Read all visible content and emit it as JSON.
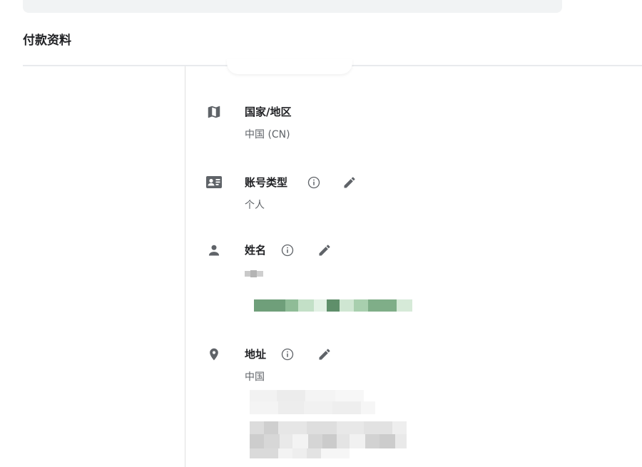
{
  "section": {
    "title": "付款资料"
  },
  "fields": {
    "country": {
      "label": "国家/地区",
      "value": "中国 (CN)",
      "icon": "map-icon"
    },
    "account_type": {
      "label": "账号类型",
      "value": "个人",
      "icon": "id-card-icon",
      "info_icon": "info-icon",
      "edit_icon": "pencil-icon"
    },
    "name": {
      "label": "姓名",
      "icon": "person-icon",
      "info_icon": "info-icon",
      "edit_icon": "pencil-icon"
    },
    "address": {
      "label": "地址",
      "value": "中国",
      "icon": "location-pin-icon",
      "info_icon": "info-icon",
      "edit_icon": "pencil-icon"
    }
  },
  "colors": {
    "icon": "#5f6368",
    "label": "#202124",
    "value": "#5f6368",
    "divider": "#e8eaed",
    "redacted_green": "#6a9a74"
  }
}
